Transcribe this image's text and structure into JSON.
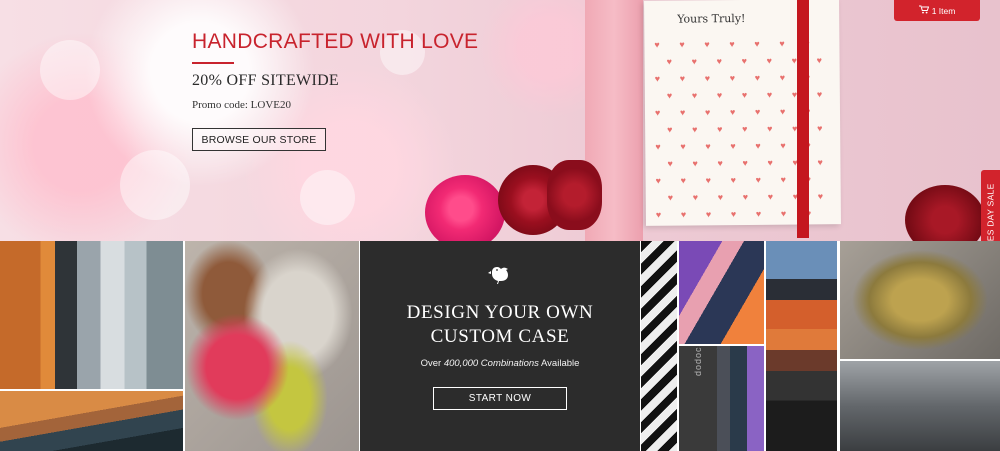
{
  "hero": {
    "title": "HANDCRAFTED WITH LOVE",
    "subtitle": "20% OFF SITEWIDE",
    "promo": "Promo code: LOVE20",
    "button": "BROWSE OUR STORE",
    "card_text": "Yours Truly!"
  },
  "cart": {
    "icon": "cart-icon",
    "label": "1 Item"
  },
  "sidetab": {
    "label": "VALENTINES DAY SALE"
  },
  "custom_case": {
    "logo_icon": "dodo-bird-icon",
    "title_line1": "DESIGN YOUR OWN",
    "title_line2": "CUSTOM CASE",
    "subtitle_prefix": "Over ",
    "subtitle_em": "400,000 Combinations",
    "subtitle_suffix": " Available",
    "button": "START NOW"
  },
  "product_text": {
    "brand_imprint": "dodocase"
  },
  "colors": {
    "brand_red": "#d2232c",
    "hero_title": "#c8232d",
    "panel_dark": "#2c2c2c"
  }
}
